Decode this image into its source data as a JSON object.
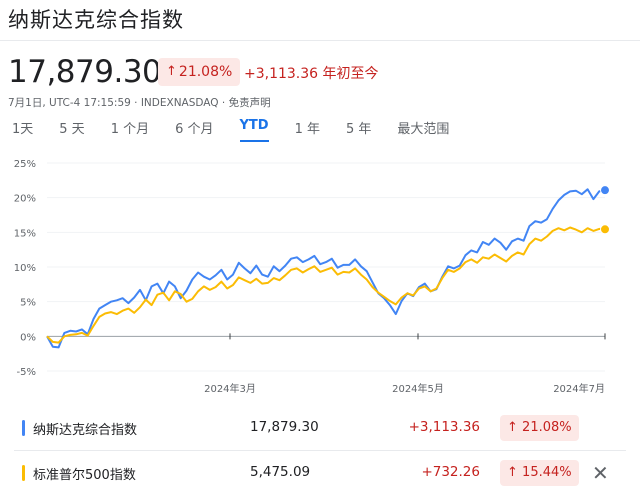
{
  "header": {
    "title": "纳斯达克综合指数",
    "price": "17,879.30",
    "pct_arrow": "↑",
    "pct": "21.08%",
    "change": "+3,113.36 年初至今",
    "meta": "7月1日, UTC-4 17:15:59 · INDEXNASDAQ · 免责声明"
  },
  "tabs": [
    {
      "label": "1天"
    },
    {
      "label": "5 天"
    },
    {
      "label": "1 个月"
    },
    {
      "label": "6 个月"
    },
    {
      "label": "YTD",
      "active": true
    },
    {
      "label": "1 年"
    },
    {
      "label": "5 年"
    },
    {
      "label": "最大范围"
    }
  ],
  "chart_data": {
    "type": "line",
    "x_tick_labels": [
      "2024年3月",
      "2024年5月",
      "2024年7月"
    ],
    "y_tick_labels": [
      "25%",
      "20%",
      "15%",
      "10%",
      "5%",
      "0%",
      "-5%"
    ],
    "ylim": [
      -5,
      25
    ],
    "series": [
      {
        "name": "纳斯达克综合指数",
        "color": "#4285f4",
        "values": [
          0,
          -1.5,
          -1.6,
          0.5,
          0.8,
          0.7,
          1,
          0.3,
          2.5,
          4,
          4.5,
          5,
          5.2,
          5.5,
          4.8,
          5.6,
          6.7,
          5.2,
          7.2,
          7.6,
          6.2,
          7.9,
          7.2,
          5.5,
          6.6,
          8.2,
          9.2,
          8.6,
          8.2,
          8.8,
          9.6,
          8.2,
          8.9,
          10.6,
          9.8,
          9.1,
          10.2,
          8.9,
          8.6,
          10.1,
          9.4,
          10.2,
          11.2,
          11.4,
          10.7,
          11.1,
          11.6,
          10.4,
          10.7,
          11.2,
          9.9,
          10.3,
          10.3,
          11.1,
          10.1,
          9.4,
          7.8,
          6.2,
          5.5,
          4.5,
          3.2,
          5.1,
          6.2,
          5.8,
          7.1,
          7.6,
          6.5,
          6.8,
          8.6,
          10.1,
          9.8,
          10.2,
          11.7,
          12.4,
          12.1,
          13.6,
          13.2,
          14.1,
          13.5,
          12.5,
          13.7,
          14.1,
          13.8,
          15.9,
          16.6,
          16.4,
          16.9,
          18.4,
          19.6,
          20.4,
          20.9,
          21.0,
          20.5,
          21.2,
          19.8,
          20.9,
          21.08
        ],
        "end_value": 21.08
      },
      {
        "name": "标准普尔500指数",
        "color": "#fbbc04",
        "values": [
          0,
          -0.8,
          -0.9,
          0,
          0.2,
          0.3,
          0.5,
          0.1,
          1.5,
          2.8,
          3.3,
          3.5,
          3.2,
          3.7,
          4,
          3.4,
          4.2,
          5.3,
          4.5,
          6,
          6.3,
          5.2,
          6.5,
          6.1,
          5,
          5.4,
          6.5,
          7.2,
          6.7,
          7.1,
          7.9,
          6.9,
          7.4,
          8.5,
          8.1,
          7.7,
          8.3,
          7.6,
          7.7,
          8.4,
          8.1,
          8.8,
          9.6,
          9.8,
          9.2,
          9.7,
          10.1,
          9.3,
          9.6,
          9.9,
          8.9,
          9.3,
          9.2,
          9.8,
          8.9,
          8.2,
          7.1,
          6.3,
          5.7,
          5.1,
          4.6,
          5.6,
          6.2,
          5.9,
          6.9,
          7.2,
          6.5,
          6.9,
          8.4,
          9.6,
          9.3,
          9.8,
          10.7,
          11.1,
          10.6,
          11.4,
          11.2,
          11.8,
          11.3,
          10.8,
          11.6,
          12.1,
          11.8,
          13.3,
          14.1,
          13.8,
          14.4,
          15.2,
          15.6,
          15.3,
          15.7,
          15.4,
          15.0,
          15.6,
          15.2,
          15.5,
          15.44
        ],
        "end_value": 15.44
      }
    ]
  },
  "legend_rows": [
    {
      "name": "纳斯达克综合指数",
      "color": "#4285f4",
      "value": "17,879.30",
      "change": "+3,113.36",
      "arrow": "↑",
      "pct": "21.08%"
    },
    {
      "name": "标准普尔500指数",
      "color": "#fbbc04",
      "value": "5,475.09",
      "change": "+732.26",
      "arrow": "↑",
      "pct": "15.44%",
      "close": "✕"
    }
  ]
}
